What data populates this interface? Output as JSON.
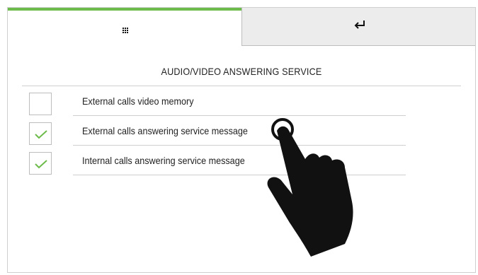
{
  "tabs": {
    "home_icon": "grid-icon",
    "back_icon": "return-arrow-icon"
  },
  "screen": {
    "title": "AUDIO/VIDEO ANSWERING SERVICE"
  },
  "options": [
    {
      "label": "External calls video memory",
      "checked": false
    },
    {
      "label": "External calls answering service message",
      "checked": true
    },
    {
      "label": "Internal calls answering service message",
      "checked": true
    }
  ],
  "colors": {
    "accent": "#6dbb4a",
    "check": "#6dbb4a",
    "tab_inactive": "#ececec",
    "rule": "#cfcfcf"
  },
  "overlay": {
    "icon": "touch-hand-icon"
  }
}
